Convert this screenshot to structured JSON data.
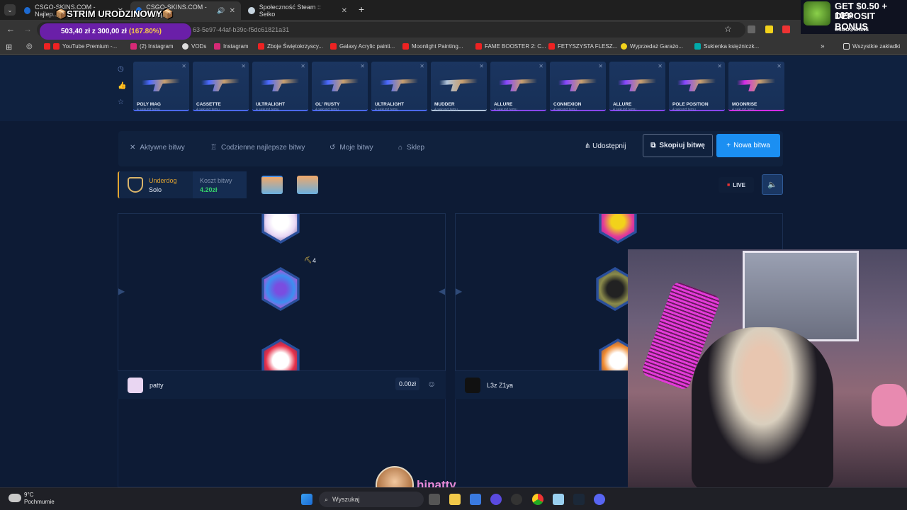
{
  "stream_overlay": {
    "title": "📦STRIM URODZINOWY📦",
    "balance_text": "503,40 zł z 300,00 zł",
    "balance_pct": "(167.80%)",
    "streamer_name": "hipatty"
  },
  "ad": {
    "line1": "GET $0.50 + 10%",
    "line2": "DEPOSIT BONUS",
    "brand": "CSGO⊙SKINS"
  },
  "browser": {
    "tabs": [
      {
        "label": "CSGO-SKINS.COM - Najlep...",
        "close": "✕"
      },
      {
        "label": "CSGO-SKINS.COM - Najlep",
        "close": "✕"
      },
      {
        "label": "Społeczność Steam :: Seiko",
        "close": "✕"
      }
    ],
    "new_tab": "+",
    "url": "63-5e97-44af-b39c-f5dc61821a31",
    "bookmarks": [
      "YouTube Premium -...",
      "(2) Instagram",
      "VODs",
      "Instagram",
      "Zboje Świętokrzyscy...",
      "Galaxy Acrylic painti...",
      "Moonlight Painting...",
      "FAME BOOSTER 2: C...",
      "FETYSZYSTA FLESZ...",
      "Wyprzedaż Garażo...",
      "Sukienka księżniczk..."
    ],
    "all_bookmarks": "Wszystkie zakładki"
  },
  "drops": [
    {
      "name": "POLY MAG",
      "sub": "4 sekund temu",
      "color": "#4b69ff"
    },
    {
      "name": "CASSETTE",
      "sub": "4 sekund temu",
      "color": "#4b69ff"
    },
    {
      "name": "ULTRALIGHT",
      "sub": "4 sekund temu",
      "color": "#4b69ff"
    },
    {
      "name": "OL' RUSTY",
      "sub": "4 sekund temu",
      "color": "#4b69ff"
    },
    {
      "name": "ULTRALIGHT",
      "sub": "4 sekund temu",
      "color": "#4b69ff"
    },
    {
      "name": "MUDDER",
      "sub": "4 sekund temu",
      "color": "#b0c3d9"
    },
    {
      "name": "ALLURE",
      "sub": "4 sekund temu",
      "color": "#8847ff"
    },
    {
      "name": "CONNEXION",
      "sub": "4 sekund temu",
      "color": "#8847ff"
    },
    {
      "name": "ALLURE",
      "sub": "4 sekund temu",
      "color": "#8847ff"
    },
    {
      "name": "POLE POSITION",
      "sub": "4 sekund temu",
      "color": "#8847ff"
    },
    {
      "name": "MOONRISE",
      "sub": "4 sekund temu",
      "color": "#d32ce6"
    }
  ],
  "nav": {
    "items": [
      "Aktywne bitwy",
      "Codzienne najlepsze bitwy",
      "Moje bitwy",
      "Sklep"
    ],
    "share": "Udostępnij",
    "copy": "Skopiuj bitwę",
    "new": "Nowa bitwa"
  },
  "battle": {
    "mode": "Underdog",
    "type": "Solo",
    "cost_label": "Koszt bitwy",
    "cost": "4.20zł",
    "live": "LIVE",
    "badge_count": "4"
  },
  "players": [
    {
      "name": "patty",
      "value": "0.00zł"
    },
    {
      "name": "L3z Z1ya"
    }
  ],
  "taskbar": {
    "temp": "9°C",
    "weather": "Pochmurnie",
    "search": "Wyszukaj"
  }
}
